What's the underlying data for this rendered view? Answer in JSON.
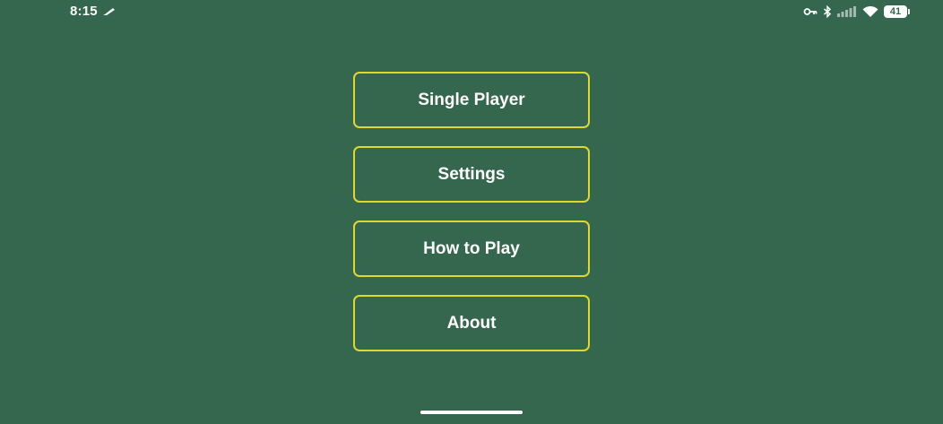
{
  "status_bar": {
    "time": "8:15",
    "battery_level": "41",
    "icons": [
      "pencil-icon",
      "key-icon",
      "bluetooth-icon",
      "signal-icon",
      "wifi-icon",
      "battery-icon"
    ]
  },
  "menu": {
    "items": [
      {
        "label": "Single Player"
      },
      {
        "label": "Settings"
      },
      {
        "label": "How to Play"
      },
      {
        "label": "About"
      }
    ]
  },
  "colors": {
    "background": "#35674f",
    "button_border": "#e0d82a",
    "text": "#ffffff"
  }
}
